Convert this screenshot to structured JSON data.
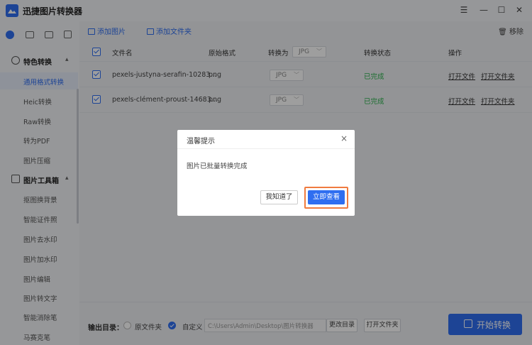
{
  "app": {
    "title": "迅捷图片转换器"
  },
  "window_controls": {
    "menu": "☰",
    "minimize": "—",
    "maximize": "☐",
    "close": "✕"
  },
  "sidebar": {
    "sections": [
      {
        "label": "特色转换",
        "items": [
          "通用格式转换",
          "Heic转换",
          "Raw转换",
          "转为PDF",
          "图片压缩"
        ]
      },
      {
        "label": "图片工具箱",
        "items": [
          "抠图换背景",
          "智能证件照",
          "图片去水印",
          "图片加水印",
          "图片编辑",
          "图片转文字",
          "智能消除笔",
          "马赛克笔"
        ]
      }
    ],
    "active_item": "通用格式转换"
  },
  "toolbar": {
    "add_image": "添加图片",
    "add_folder": "添加文件夹",
    "remove": "移除"
  },
  "table": {
    "headers": {
      "filename": "文件名",
      "orig_format": "原始格式",
      "convert_to": "转换为",
      "status": "转换状态",
      "actions": "操作"
    },
    "header_format": "JPG",
    "rows": [
      {
        "filename": "pexels-justyna-serafin-10283...",
        "orig_format": "png",
        "target": "JPG",
        "status": "已完成",
        "open_file": "打开文件",
        "open_folder": "打开文件夹"
      },
      {
        "filename": "pexels-clément-proust-14683...",
        "orig_format": "png",
        "target": "JPG",
        "status": "已完成",
        "open_file": "打开文件",
        "open_folder": "打开文件夹"
      }
    ]
  },
  "bottom": {
    "output_label": "输出目录：",
    "option_original": "原文件夹",
    "option_custom": "自定义",
    "path": "C:\\Users\\Admin\\Desktop\\图片转换器",
    "change_dir": "更改目录",
    "open_folder": "打开文件夹",
    "start": "开始转换"
  },
  "dialog": {
    "title": "温馨提示",
    "message": "图片已批量转换完成",
    "btn_ok": "我知道了",
    "btn_view": "立即查看"
  },
  "colors": {
    "accent": "#2f6ef0",
    "success": "#2bb24c",
    "highlight": "#f07b3f"
  }
}
